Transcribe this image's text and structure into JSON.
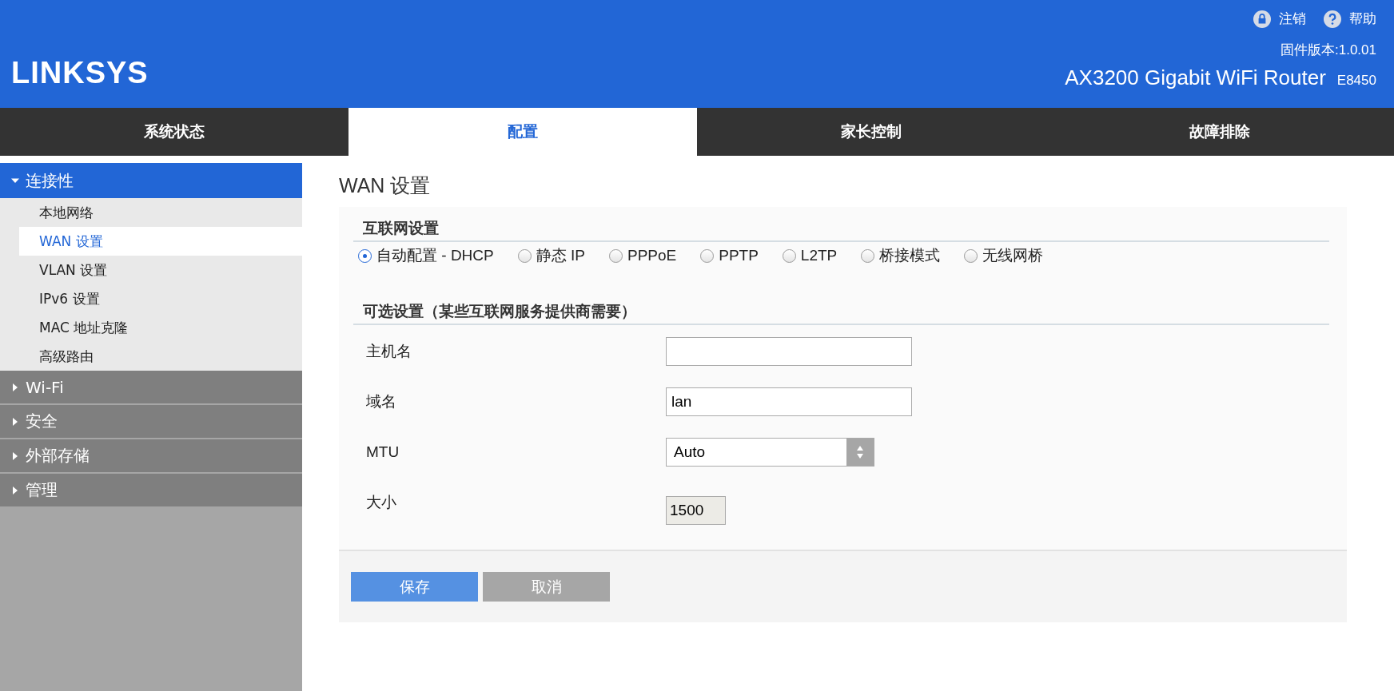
{
  "header": {
    "logo": "LINKSYS",
    "links": [
      {
        "kind": "lock",
        "label": "注销"
      },
      {
        "kind": "help",
        "label": "帮助"
      }
    ],
    "firmware": "固件版本:1.0.01",
    "product": "AX3200 Gigabit WiFi Router",
    "model": "E8450"
  },
  "tabs": [
    {
      "label": "系统状态",
      "selected": false
    },
    {
      "label": "配置",
      "selected": true
    },
    {
      "label": "家长控制",
      "selected": false
    },
    {
      "label": "故障排除",
      "selected": false
    }
  ],
  "sidebar": {
    "groups": [
      {
        "label": "连接性",
        "expanded": true,
        "children": [
          {
            "label": "本地网络",
            "selected": false
          },
          {
            "label": "WAN 设置",
            "selected": true
          },
          {
            "label": "VLAN 设置",
            "selected": false
          },
          {
            "label": "IPv6 设置",
            "selected": false
          },
          {
            "label": "MAC 地址克隆",
            "selected": false
          },
          {
            "label": "高级路由",
            "selected": false
          }
        ]
      },
      {
        "label": "Wi-Fi",
        "expanded": false
      },
      {
        "label": "安全",
        "expanded": false
      },
      {
        "label": "外部存储",
        "expanded": false
      },
      {
        "label": "管理",
        "expanded": false
      }
    ]
  },
  "page_title": "WAN 设置",
  "internet_settings": {
    "heading": "互联网设置",
    "options": [
      {
        "label": "自动配置 - DHCP",
        "selected": true
      },
      {
        "label": "静态 IP",
        "selected": false
      },
      {
        "label": "PPPoE",
        "selected": false
      },
      {
        "label": "PPTP",
        "selected": false
      },
      {
        "label": "L2TP",
        "selected": false
      },
      {
        "label": "桥接模式",
        "selected": false
      },
      {
        "label": "无线网桥",
        "selected": false
      }
    ]
  },
  "optional_settings": {
    "heading": "可选设置（某些互联网服务提供商需要）",
    "fields": [
      {
        "kind": "text",
        "label": "主机名"
      },
      {
        "kind": "text",
        "label": "域名",
        "value": "lan"
      },
      {
        "kind": "select",
        "label": "MTU",
        "value": "Auto"
      },
      {
        "kind": "readonly",
        "label": "大小",
        "value": "1500"
      }
    ]
  },
  "buttons": [
    {
      "kind": "primary",
      "label": "保存"
    },
    {
      "kind": "secondary",
      "label": "取消"
    }
  ]
}
